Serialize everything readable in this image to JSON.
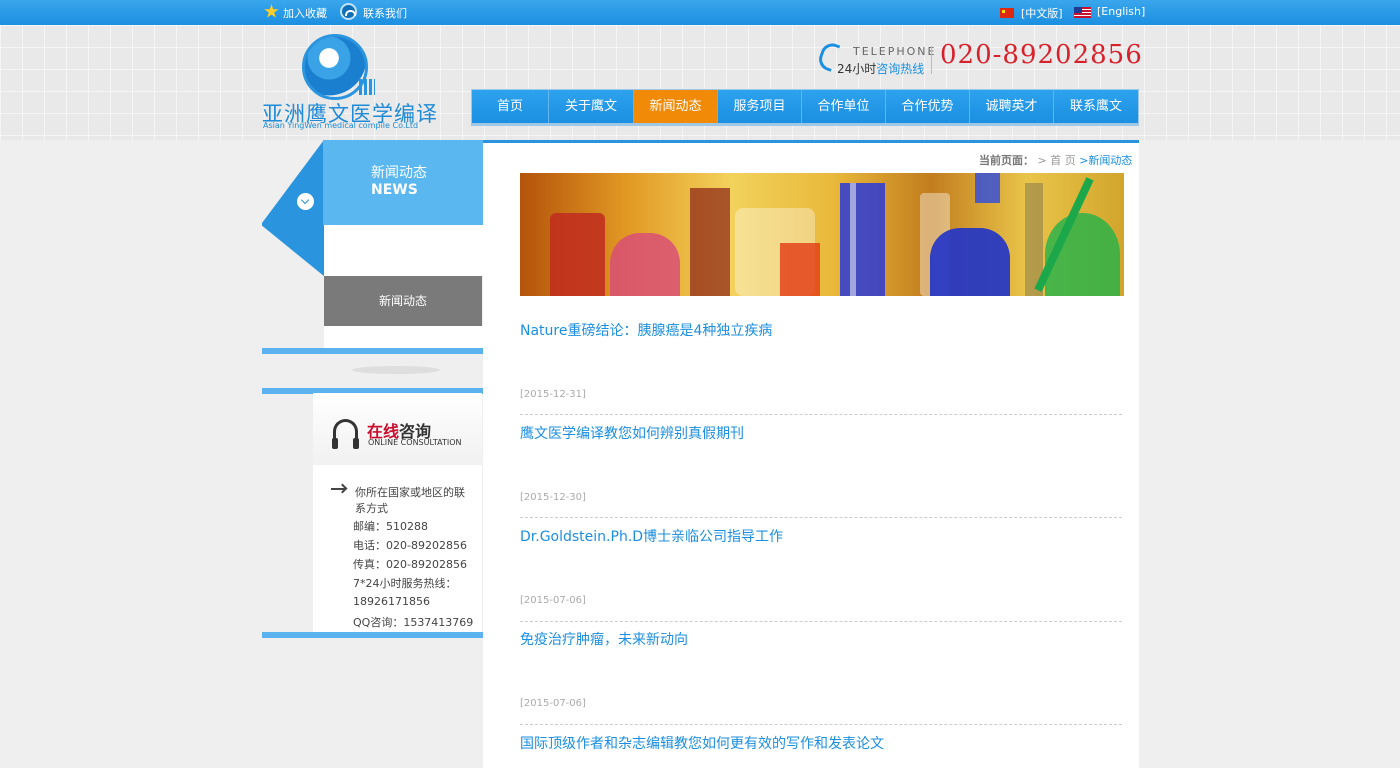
{
  "topbar": {
    "bookmark": "加入收藏",
    "contact": "联系我们",
    "lang_cn": "[中文版]",
    "lang_en": "[English]"
  },
  "logo": {
    "name_cn": "亚洲鹰文医学编译",
    "name_en": "Asian YingWen medical compile Co.Ltd"
  },
  "hotline": {
    "label_en": "TELEPHONE",
    "label_cn_prefix": "24小时",
    "label_cn_highlight": "咨询热线",
    "number": "020-89202856"
  },
  "nav": {
    "items": [
      "首页",
      "关于鹰文",
      "新闻动态",
      "服务项目",
      "合作单位",
      "合作优势",
      "诚聘英才",
      "联系鹰文"
    ],
    "active_index": 2
  },
  "sidebar": {
    "title_cn": "新闻动态",
    "title_en": "NEWS",
    "active_item": "新闻动态"
  },
  "consult": {
    "title_accent": "在线",
    "title_rest": "咨询",
    "subtitle": "ONLINE CONSULTATION",
    "intro_line1": "你所在国家或地区的联",
    "intro_line2": "系方式",
    "postcode": "邮编：510288",
    "phone": "电话：020-89202856",
    "fax": "传真：020-89202856",
    "hotline_label": "7*24小时服务热线：",
    "hotline_number": "18926171856",
    "qq": "QQ咨询：1537413769"
  },
  "breadcrumb": {
    "label": "当前页面：",
    "home": "> 首 页",
    "current": ">新闻动态"
  },
  "news": [
    {
      "title": "Nature重磅结论：胰腺癌是4种独立疾病",
      "date": "[2015-12-31]"
    },
    {
      "title": "鹰文医学编译教您如何辨别真假期刊",
      "date": "[2015-12-30]"
    },
    {
      "title": "Dr.Goldstein.Ph.D博士亲临公司指导工作",
      "date": "[2015-07-06]"
    },
    {
      "title": "免疫治疗肿瘤，未来新动向",
      "date": "[2015-07-06]"
    },
    {
      "title": "国际顶级作者和杂志编辑教您如何更有效的写作和发表论文",
      "date": ""
    }
  ],
  "colors": {
    "brand_blue": "#1b8fe1",
    "active_orange": "#f08a07",
    "hotline_red": "#d8212b"
  }
}
